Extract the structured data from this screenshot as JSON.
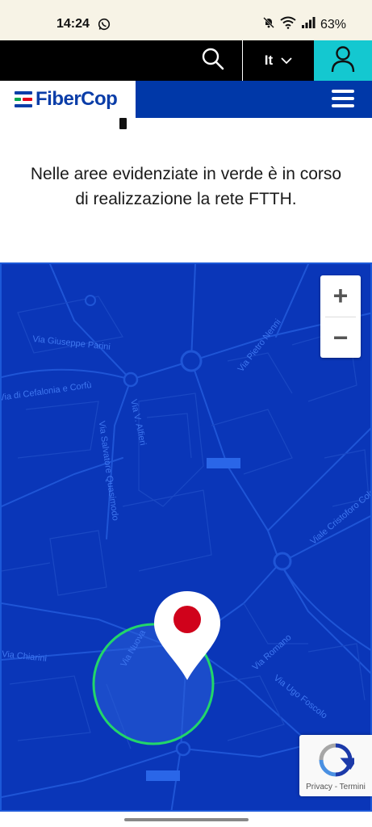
{
  "status_bar": {
    "time": "14:24",
    "battery": "63%"
  },
  "top_bar": {
    "language": "It"
  },
  "nav": {
    "logo_text": "FiberCop"
  },
  "info": {
    "text": "Nelle aree evidenziate in verde è in corso di realizzazione la rete FTTH."
  },
  "map": {
    "street_labels": {
      "parini": "Via Giuseppe Parini",
      "cefalonia": "Via di Cefalonia e Corfù",
      "alfieri": "Via V. Alfieri",
      "quasimodo": "Via Salvatore Quasimodo",
      "nenni": "Via Pietro Nenni",
      "colombo": "Viale Cristoforo Colombo",
      "chiarini": "Via Chiarini",
      "romano": "Via Romano",
      "foscolo": "Via Ugo Foscolo",
      "vianuova": "Via Nuova"
    },
    "zoom_in": "+",
    "zoom_out": "−",
    "highlight_color": "#22d66a",
    "pin_color": "#d0021b"
  },
  "recaptcha": {
    "text": "Privacy - Termini"
  },
  "colors": {
    "brand_blue": "#0038a8",
    "accent_cyan": "#14c8d0"
  }
}
